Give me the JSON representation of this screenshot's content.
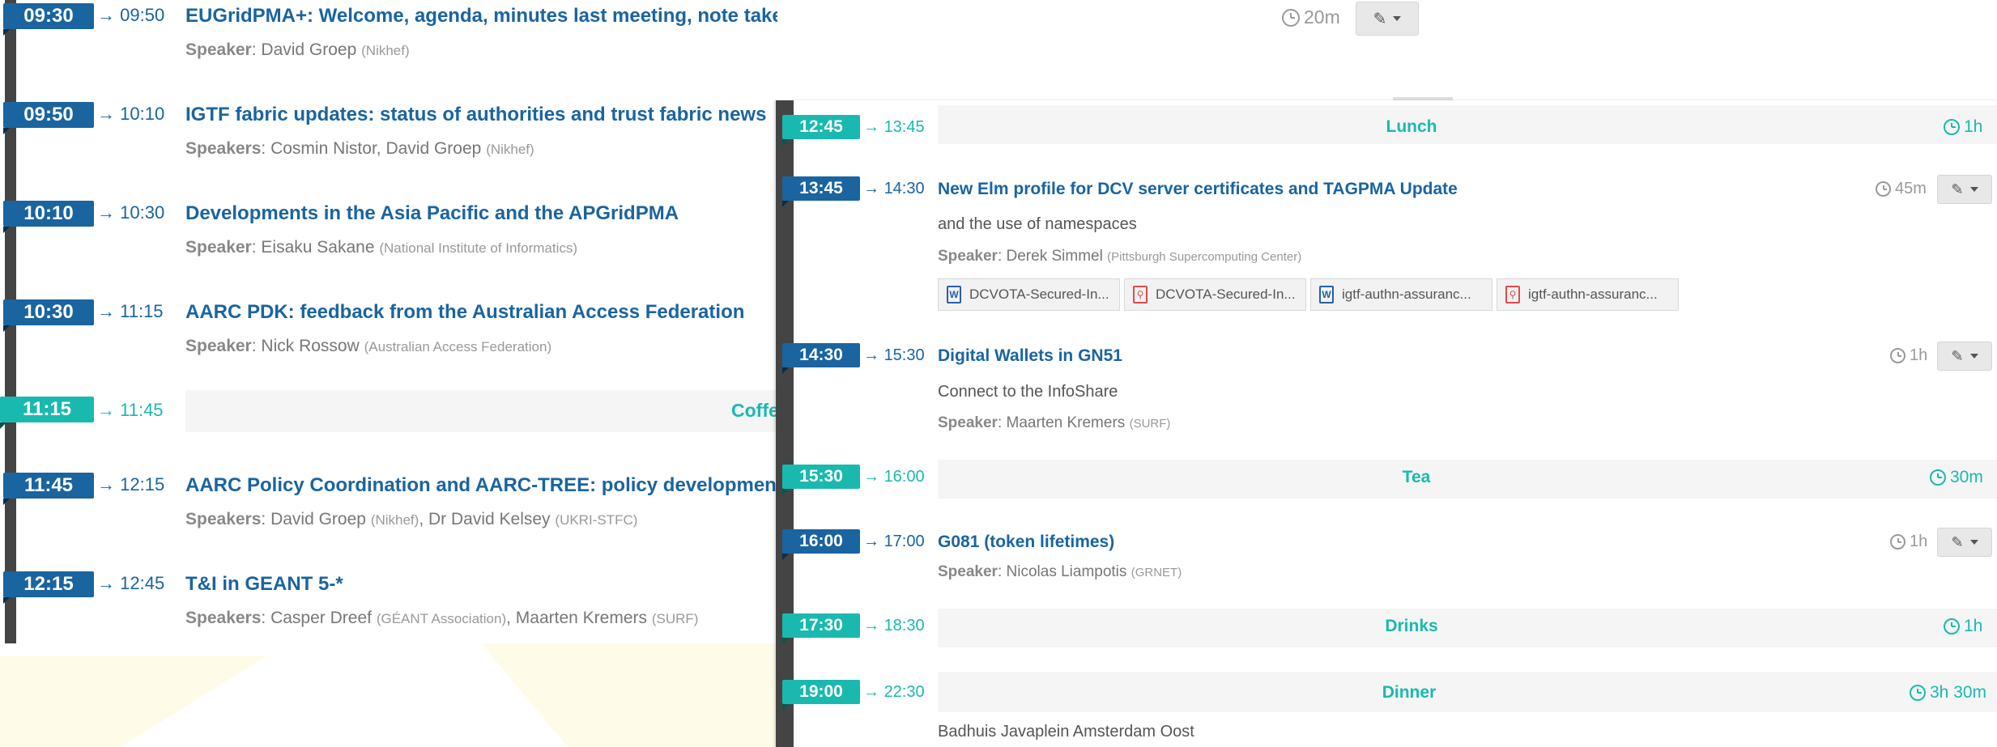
{
  "left_entries": [
    {
      "start": "09:30",
      "end": "09:50",
      "title": "EUGridPMA+: Welcome, agenda, minutes last meeting, note taker, introductions",
      "speakers_label": "Speaker",
      "speakers": [
        {
          "name": "David Groep",
          "affiliation": "(Nikhef)"
        }
      ],
      "duration": "20m"
    },
    {
      "start": "09:50",
      "end": "10:10",
      "title": "IGTF fabric updates: status of authorities and trust fabric news",
      "speakers_label": "Speakers",
      "speakers": [
        {
          "name": "Cosmin Nistor, David Groep",
          "affiliation": "(Nikhef)"
        }
      ]
    },
    {
      "start": "10:10",
      "end": "10:30",
      "title": "Developments in the Asia Pacific and the APGridPMA",
      "speakers_label": "Speaker",
      "speakers": [
        {
          "name": "Eisaku Sakane",
          "affiliation": "(National Institute of Informatics)"
        }
      ]
    },
    {
      "start": "10:30",
      "end": "11:15",
      "title": "AARC PDK: feedback from the Australian Access Federation",
      "speakers_label": "Speaker",
      "speakers": [
        {
          "name": "Nick Rossow",
          "affiliation": "(Australian Access Federation)"
        }
      ]
    },
    {
      "start": "11:15",
      "end": "11:45",
      "title": "Coffe"
    },
    {
      "start": "11:45",
      "end": "12:15",
      "title": "AARC Policy Coordination and AARC-TREE: policy development",
      "speakers_label": "Speakers",
      "speakers": [
        {
          "name": "David Groep",
          "affiliation": "(Nikhef)"
        },
        {
          "name": "Dr David Kelsey",
          "affiliation": "(UKRI-STFC)"
        }
      ]
    },
    {
      "start": "12:15",
      "end": "12:45",
      "title": "T&I in GEANT 5-*",
      "speakers_label": "Speakers",
      "speakers": [
        {
          "name": "Casper Dreef",
          "affiliation": "(GÉANT Association)"
        },
        {
          "name": "Maarten Kremers",
          "affiliation": "(SURF)"
        }
      ]
    }
  ],
  "right_entries": [
    {
      "start": "12:45",
      "end": "13:45",
      "title": "Lunch",
      "duration": "1h"
    },
    {
      "start": "13:45",
      "end": "14:30",
      "title": "New Elm profile for DCV server certificates and TAGPMA Update",
      "description": "and the use of namespaces",
      "speakers_label": "Speaker",
      "speakers": [
        {
          "name": "Derek Simmel",
          "affiliation": "(Pittsburgh Supercomputing Center)"
        }
      ],
      "duration": "45m",
      "attachments": [
        {
          "type": "word",
          "name": "DCVOTA-Secured-In..."
        },
        {
          "type": "pdf",
          "name": "DCVOTA-Secured-In..."
        },
        {
          "type": "word",
          "name": "igtf-authn-assuranc..."
        },
        {
          "type": "pdf",
          "name": "igtf-authn-assuranc..."
        }
      ]
    },
    {
      "start": "14:30",
      "end": "15:30",
      "title": "Digital Wallets in GN51",
      "description": "Connect to the InfoShare",
      "speakers_label": "Speaker",
      "speakers": [
        {
          "name": "Maarten Kremers",
          "affiliation": "(SURF)"
        }
      ],
      "duration": "1h"
    },
    {
      "start": "15:30",
      "end": "16:00",
      "title": "Tea",
      "duration": "30m"
    },
    {
      "start": "16:00",
      "end": "17:00",
      "title": "G081 (token lifetimes)",
      "speakers_label": "Speaker",
      "speakers": [
        {
          "name": "Nicolas Liampotis",
          "affiliation": "(GRNET)"
        }
      ],
      "duration": "1h"
    },
    {
      "start": "17:30",
      "end": "18:30",
      "title": "Drinks",
      "duration": "1h"
    },
    {
      "start": "19:00",
      "end": "22:30",
      "title": "Dinner",
      "duration": "3h 30m",
      "description": "Badhuis Javaplein Amsterdam Oost"
    }
  ],
  "ui": {
    "arrow": "→",
    "file_word_glyph": "W",
    "file_pdf_glyph": "⚲"
  },
  "colors": {
    "contribution": "#1a64a0",
    "break": "#1ab9af",
    "rail": "#444444"
  }
}
